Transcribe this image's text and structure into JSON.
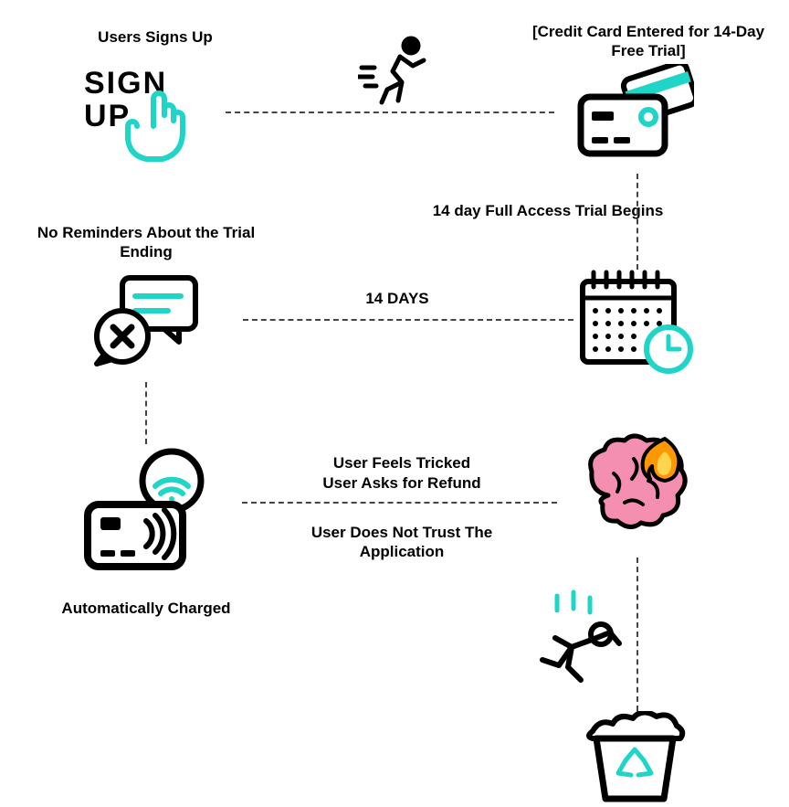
{
  "labels": {
    "signup": "Users Signs Up",
    "credit_card": "[Credit Card Entered for 14-Day Free Trial]",
    "trial_begins": "14 day Full Access Trial Begins",
    "fourteen_days": "14 DAYS",
    "no_reminders": "No Reminders About the Trial Ending",
    "auto_charged": "Automatically Charged",
    "tricked": "User Feels Tricked",
    "refund": "User Asks for Refund",
    "no_trust": "User Does Not Trust The Application"
  },
  "colors": {
    "accent": "#1fd5c8",
    "pink": "#f06292",
    "orange": "#ff7800"
  }
}
